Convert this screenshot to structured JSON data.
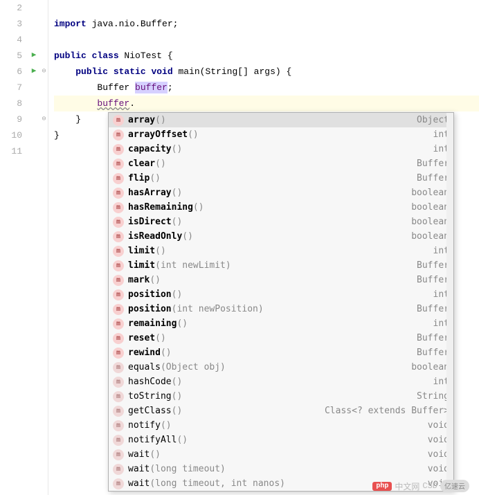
{
  "gutter": {
    "lines": [
      "2",
      "3",
      "4",
      "5",
      "6",
      "7",
      "8",
      "9",
      "10",
      "11"
    ],
    "run_markers": [
      3,
      4
    ],
    "fold_open": 4,
    "fold_close": 7
  },
  "code": {
    "l2": "",
    "l3_import": "import",
    "l3_pkg": " java.nio.Buffer;",
    "l4": "",
    "l5_public": "public",
    "l5_class": " class",
    "l5_name": " NioTest {",
    "l6_indent": "    ",
    "l6_public": "public",
    "l6_static": " static",
    "l6_void": " void",
    "l6_main": " main",
    "l6_params": "(String[] args) {",
    "l7_indent": "        ",
    "l7_type": "Buffer ",
    "l7_var": "buffer",
    "l7_semi": ";",
    "l8_indent": "        ",
    "l8_var": "buffer",
    "l8_dot": ".",
    "l9_indent": "    }",
    "l10_close": "}"
  },
  "completion": {
    "items": [
      {
        "icon": "m",
        "bold": true,
        "name": "array",
        "params": "()",
        "return": "Object",
        "selected": true
      },
      {
        "icon": "m",
        "bold": true,
        "name": "arrayOffset",
        "params": "()",
        "return": "int"
      },
      {
        "icon": "m",
        "bold": true,
        "name": "capacity",
        "params": "()",
        "return": "int"
      },
      {
        "icon": "m",
        "bold": true,
        "name": "clear",
        "params": "()",
        "return": "Buffer"
      },
      {
        "icon": "m",
        "bold": true,
        "name": "flip",
        "params": "()",
        "return": "Buffer"
      },
      {
        "icon": "m",
        "bold": true,
        "name": "hasArray",
        "params": "()",
        "return": "boolean"
      },
      {
        "icon": "m",
        "bold": true,
        "name": "hasRemaining",
        "params": "()",
        "return": "boolean"
      },
      {
        "icon": "m",
        "bold": true,
        "name": "isDirect",
        "params": "()",
        "return": "boolean"
      },
      {
        "icon": "m",
        "bold": true,
        "name": "isReadOnly",
        "params": "()",
        "return": "boolean"
      },
      {
        "icon": "m",
        "bold": true,
        "name": "limit",
        "params": "()",
        "return": "int"
      },
      {
        "icon": "m",
        "bold": true,
        "name": "limit",
        "params": "(int newLimit)",
        "return": "Buffer"
      },
      {
        "icon": "m",
        "bold": true,
        "name": "mark",
        "params": "()",
        "return": "Buffer"
      },
      {
        "icon": "m",
        "bold": true,
        "name": "position",
        "params": "()",
        "return": "int"
      },
      {
        "icon": "m",
        "bold": true,
        "name": "position",
        "params": "(int newPosition)",
        "return": "Buffer"
      },
      {
        "icon": "m",
        "bold": true,
        "name": "remaining",
        "params": "()",
        "return": "int"
      },
      {
        "icon": "m",
        "bold": true,
        "name": "reset",
        "params": "()",
        "return": "Buffer"
      },
      {
        "icon": "m",
        "bold": true,
        "name": "rewind",
        "params": "()",
        "return": "Buffer"
      },
      {
        "icon": "m",
        "bold": false,
        "name": "equals",
        "params": "(Object obj)",
        "return": "boolean"
      },
      {
        "icon": "m",
        "bold": false,
        "name": "hashCode",
        "params": "()",
        "return": "int"
      },
      {
        "icon": "m",
        "bold": false,
        "name": "toString",
        "params": "()",
        "return": "String"
      },
      {
        "icon": "m",
        "bold": false,
        "name": "getClass",
        "params": "()",
        "return": "Class<? extends Buffer>"
      },
      {
        "icon": "m",
        "bold": false,
        "name": "notify",
        "params": "()",
        "return": "void"
      },
      {
        "icon": "m",
        "bold": false,
        "name": "notifyAll",
        "params": "()",
        "return": "void"
      },
      {
        "icon": "m",
        "bold": false,
        "name": "wait",
        "params": "()",
        "return": "void"
      },
      {
        "icon": "m",
        "bold": false,
        "name": "wait",
        "params": "(long timeout)",
        "return": "void"
      },
      {
        "icon": "m",
        "bold": false,
        "name": "wait",
        "params": "(long timeout, int nanos)",
        "return": "void"
      }
    ]
  },
  "watermark": {
    "badge": "php",
    "text1": "中文网",
    "circle": "CSD",
    "text2": "亿速云"
  }
}
